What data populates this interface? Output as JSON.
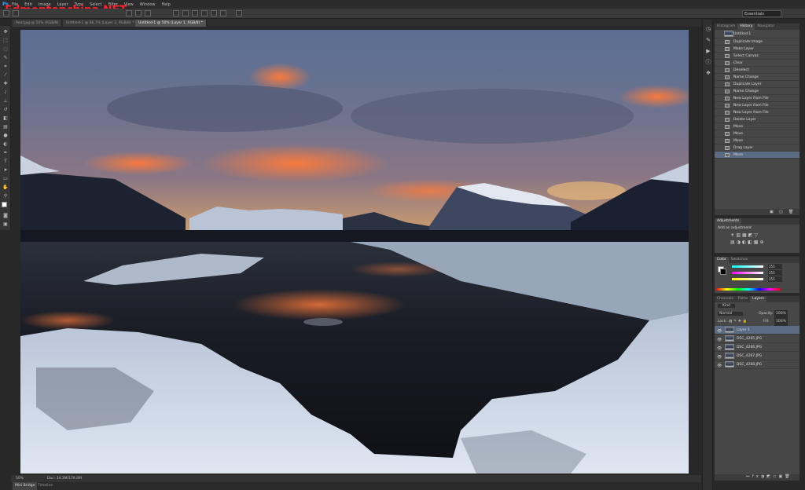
{
  "app": {
    "logo": "Ps",
    "workspace": "Essentials"
  },
  "watermark": "Edmontonchina.NET",
  "menu": [
    "File",
    "Edit",
    "Image",
    "Layer",
    "Type",
    "Select",
    "Filter",
    "View",
    "Window",
    "Help"
  ],
  "tabs": [
    {
      "label": "Real.jpg @ 50% (RGB/8)",
      "active": false
    },
    {
      "label": "Untitled-1 @ 66.7% (Layer 2, RGB/8) *",
      "active": false
    },
    {
      "label": "Untitled-1 @ 50% (Layer 1, RGB/8) *",
      "active": true
    }
  ],
  "history_panel": {
    "tabs": [
      "Histogram",
      "History",
      "Navigator"
    ],
    "snapshot": "Untitled-1",
    "items": [
      "Duplicate Image",
      "Make Layer",
      "Select Canvas",
      "Clear",
      "Deselect",
      "Name Change",
      "Duplicate Layer",
      "Name Change",
      "New Layer from File",
      "New Layer from File",
      "New Layer from File",
      "Delete Layer",
      "Move",
      "Move",
      "Move",
      "Drag Layer",
      "Move"
    ]
  },
  "adjustments_panel": {
    "tabs": [
      "Adjustments"
    ],
    "hint": "Add an adjustment"
  },
  "color_panel": {
    "tabs": [
      "Color",
      "Swatches"
    ],
    "r": "255",
    "g": "255",
    "b": "255"
  },
  "layers_panel": {
    "tabs": [
      "Channels",
      "Paths",
      "Layers"
    ],
    "filter_kind": "Kind",
    "blend_mode": "Normal",
    "opacity_label": "Opacity:",
    "opacity": "100%",
    "lock_label": "Lock:",
    "fill_label": "Fill:",
    "fill": "100%",
    "layers": [
      "Layer 1",
      "DSC_4265.JPG",
      "DSC_4266.JPG",
      "DSC_4267.JPG",
      "DSC_4268.JPG"
    ]
  },
  "status": {
    "zoom": "50%",
    "doc": "Doc: 34.3M/179.0M"
  },
  "bottom_tabs": [
    "Mini Bridge",
    "Timeline"
  ],
  "colors": {
    "selection": "#5a6b82",
    "panel_bg": "#474747",
    "accent": "#31a8ff"
  }
}
